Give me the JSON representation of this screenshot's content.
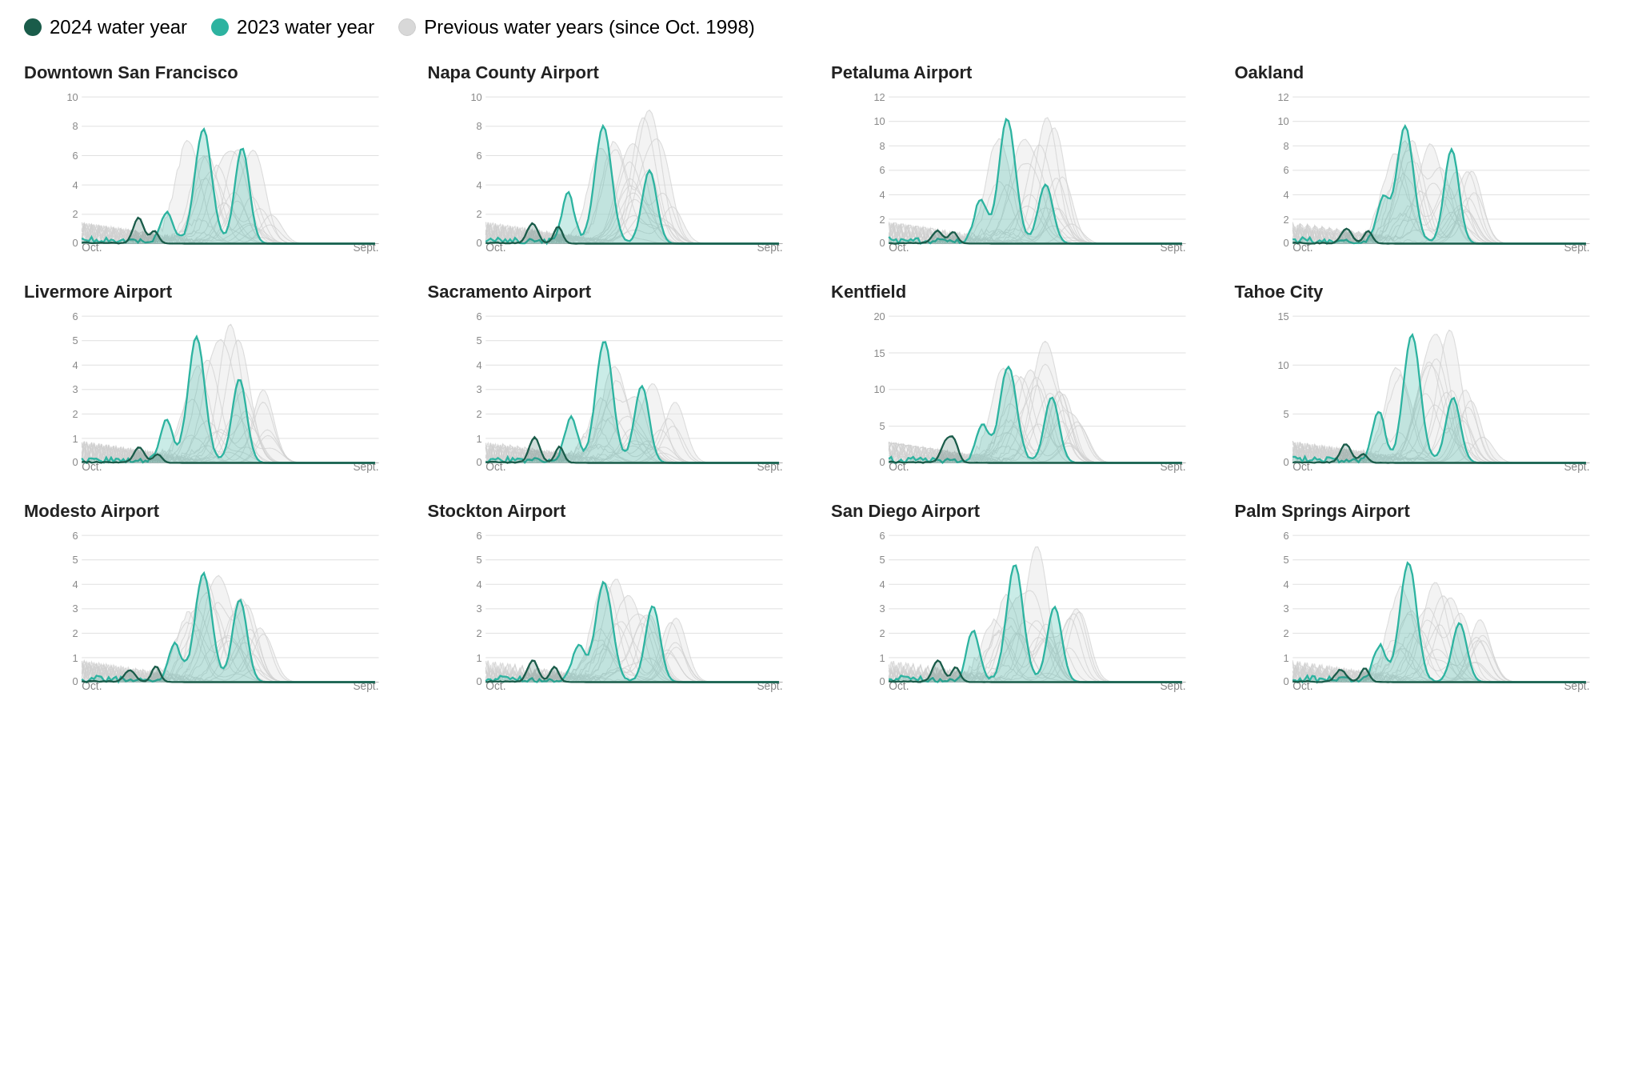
{
  "legend": {
    "items": [
      {
        "id": "2024",
        "label": "2024 water year",
        "color": "#1a5c4a"
      },
      {
        "id": "2023",
        "label": "2023 water year",
        "color": "#2db3a0"
      },
      {
        "id": "prev",
        "label": "Previous water years (since Oct. 1998)",
        "color": "#d8d8d8"
      }
    ]
  },
  "charts": [
    {
      "id": "downtown-sf",
      "title": "Downtown San Francisco",
      "yMax": 10,
      "yTicks": [
        0,
        2,
        4,
        6,
        8,
        10
      ]
    },
    {
      "id": "napa-county-airport",
      "title": "Napa County Airport",
      "yMax": 10,
      "yTicks": [
        0,
        2,
        4,
        6,
        8,
        10
      ]
    },
    {
      "id": "petaluma-airport",
      "title": "Petaluma Airport",
      "yMax": 12,
      "yTicks": [
        0,
        2,
        4,
        6,
        8,
        10,
        12
      ]
    },
    {
      "id": "oakland",
      "title": "Oakland",
      "yMax": 12,
      "yTicks": [
        0,
        2,
        4,
        6,
        8,
        10,
        12
      ]
    },
    {
      "id": "livermore-airport",
      "title": "Livermore Airport",
      "yMax": 6,
      "yTicks": [
        0,
        1,
        2,
        3,
        4,
        5,
        6
      ]
    },
    {
      "id": "sacramento-airport",
      "title": "Sacramento Airport",
      "yMax": 6,
      "yTicks": [
        0,
        1,
        2,
        3,
        4,
        5,
        6
      ]
    },
    {
      "id": "kentfield",
      "title": "Kentfield",
      "yMax": 20,
      "yTicks": [
        0,
        5,
        10,
        15,
        20
      ]
    },
    {
      "id": "tahoe-city",
      "title": "Tahoe City",
      "yMax": 15,
      "yTicks": [
        0,
        5,
        10,
        15
      ]
    },
    {
      "id": "modesto-airport",
      "title": "Modesto Airport",
      "yMax": 6,
      "yTicks": [
        0,
        1,
        2,
        3,
        4,
        5,
        6
      ]
    },
    {
      "id": "stockton-airport",
      "title": "Stockton Airport",
      "yMax": 6,
      "yTicks": [
        0,
        1,
        2,
        3,
        4,
        5,
        6
      ]
    },
    {
      "id": "san-diego-airport",
      "title": "San Diego Airport",
      "yMax": 6,
      "yTicks": [
        0,
        1,
        2,
        3,
        4,
        5,
        6
      ]
    },
    {
      "id": "palm-springs-airport",
      "title": "Palm Springs Airport",
      "yMax": 6,
      "yTicks": [
        0,
        1,
        2,
        3,
        4,
        5,
        6
      ]
    }
  ],
  "axis": {
    "xStart": "Oct.",
    "xEnd": "Sept."
  }
}
